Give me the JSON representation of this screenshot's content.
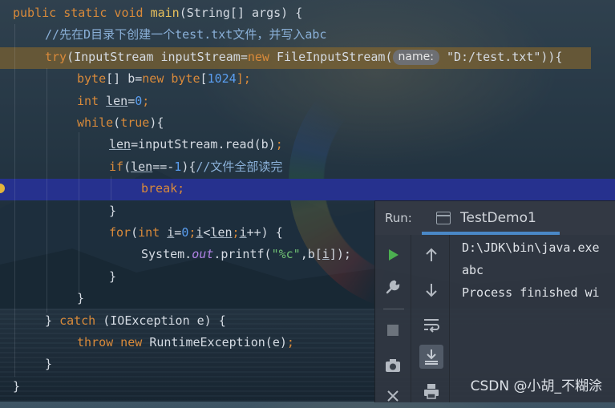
{
  "code_lines": [
    {
      "indent": 0,
      "tokens": [
        {
          "t": "public static void ",
          "c": "kw"
        },
        {
          "t": "main",
          "c": "fn"
        },
        {
          "t": "(String[] args) {",
          "c": "plain"
        }
      ]
    },
    {
      "indent": 1,
      "tokens": [
        {
          "t": "//先在D目录下创建一个test.txt文件，并写入abc",
          "c": "cm"
        }
      ]
    },
    {
      "indent": 1,
      "tokens": [
        {
          "t": "try",
          "c": "kw"
        },
        {
          "t": "(InputStream inputStream=",
          "c": "plain"
        },
        {
          "t": "new ",
          "c": "kw"
        },
        {
          "t": "FileInputStream(",
          "c": "plain"
        },
        {
          "t": "name:",
          "c": "hint"
        },
        {
          "t": "\"D:/test.txt\"",
          "c": "plain"
        },
        {
          "t": ")){",
          "c": "plain"
        }
      ]
    },
    {
      "indent": 2,
      "tokens": [
        {
          "t": "byte",
          "c": "kw"
        },
        {
          "t": "[] b=",
          "c": "plain"
        },
        {
          "t": "new ",
          "c": "kw"
        },
        {
          "t": "byte",
          "c": "kw"
        },
        {
          "t": "[",
          "c": "plain"
        },
        {
          "t": "1024",
          "c": "num"
        },
        {
          "t": "];",
          "c": "kw"
        }
      ]
    },
    {
      "indent": 2,
      "tokens": [
        {
          "t": "int ",
          "c": "kw"
        },
        {
          "t": "len",
          "c": "ul"
        },
        {
          "t": "=",
          "c": "plain"
        },
        {
          "t": "0",
          "c": "num"
        },
        {
          "t": ";",
          "c": "kw"
        }
      ]
    },
    {
      "indent": 2,
      "tokens": [
        {
          "t": "while",
          "c": "kw"
        },
        {
          "t": "(",
          "c": "plain"
        },
        {
          "t": "true",
          "c": "kw"
        },
        {
          "t": "){",
          "c": "plain"
        }
      ]
    },
    {
      "indent": 3,
      "tokens": [
        {
          "t": "len",
          "c": "ul"
        },
        {
          "t": "=inputStream.read(b)",
          "c": "plain"
        },
        {
          "t": ";",
          "c": "kw"
        }
      ]
    },
    {
      "indent": 3,
      "tokens": [
        {
          "t": "if",
          "c": "kw"
        },
        {
          "t": "(",
          "c": "plain"
        },
        {
          "t": "len",
          "c": "ul"
        },
        {
          "t": "==-",
          "c": "plain"
        },
        {
          "t": "1",
          "c": "num"
        },
        {
          "t": "){",
          "c": "plain"
        },
        {
          "t": "//文件全部读完",
          "c": "cm"
        }
      ]
    },
    {
      "indent": 4,
      "tokens": [
        {
          "t": "break",
          "c": "kw"
        },
        {
          "t": ";",
          "c": "kw"
        }
      ]
    },
    {
      "indent": 3,
      "tokens": [
        {
          "t": "}",
          "c": "plain"
        }
      ]
    },
    {
      "indent": 3,
      "tokens": [
        {
          "t": "for",
          "c": "kw"
        },
        {
          "t": "(",
          "c": "plain"
        },
        {
          "t": "int ",
          "c": "kw"
        },
        {
          "t": "i",
          "c": "ul"
        },
        {
          "t": "=",
          "c": "plain"
        },
        {
          "t": "0",
          "c": "num"
        },
        {
          "t": ";",
          "c": "kw"
        },
        {
          "t": "i",
          "c": "ul"
        },
        {
          "t": "<",
          "c": "plain"
        },
        {
          "t": "len",
          "c": "ul"
        },
        {
          "t": ";",
          "c": "kw"
        },
        {
          "t": "i",
          "c": "ul"
        },
        {
          "t": "++) {",
          "c": "plain"
        }
      ]
    },
    {
      "indent": 4,
      "tokens": [
        {
          "t": "System.",
          "c": "plain"
        },
        {
          "t": "out",
          "c": "it"
        },
        {
          "t": ".printf(",
          "c": "plain"
        },
        {
          "t": "\"%c\"",
          "c": "str"
        },
        {
          "t": ",b[",
          "c": "plain"
        },
        {
          "t": "i",
          "c": "ul"
        },
        {
          "t": "]);",
          "c": "plain"
        }
      ]
    },
    {
      "indent": 3,
      "tokens": [
        {
          "t": "}",
          "c": "plain"
        }
      ]
    },
    {
      "indent": 2,
      "tokens": [
        {
          "t": "}",
          "c": "plain"
        }
      ]
    },
    {
      "indent": 1,
      "tokens": [
        {
          "t": "} ",
          "c": "plain"
        },
        {
          "t": "catch ",
          "c": "kw"
        },
        {
          "t": "(IOException e) {",
          "c": "plain"
        }
      ]
    },
    {
      "indent": 2,
      "tokens": [
        {
          "t": "throw new ",
          "c": "kw"
        },
        {
          "t": "RuntimeException(e)",
          "c": "plain"
        },
        {
          "t": ";",
          "c": "kw"
        }
      ]
    },
    {
      "indent": 1,
      "tokens": [
        {
          "t": "}",
          "c": "plain"
        }
      ]
    },
    {
      "indent": 0,
      "tokens": [
        {
          "t": "}",
          "c": "plain"
        }
      ]
    }
  ],
  "run_panel": {
    "label": "Run:",
    "tab_label": "TestDemo1",
    "console_lines": [
      "D:\\JDK\\bin\\java.exe",
      "abc",
      "Process finished wi"
    ],
    "left_toolbar": [
      "run-icon",
      "wrench-icon",
      "stop-icon",
      "camera-icon",
      "exit-icon"
    ],
    "right_toolbar": [
      "arrow-up-icon",
      "arrow-down-icon",
      "soft-wrap-icon",
      "scroll-to-end-icon",
      "print-icon"
    ]
  },
  "watermark": "CSDN @小胡_不糊涂",
  "colors": {
    "keyword": "#d98a3a",
    "function": "#e8c15c",
    "number": "#5a9ef0",
    "comment": "#8ab0d8",
    "string": "#6fbf73",
    "field": "#b183e6",
    "break_line_highlight": "#26318e",
    "try_line_highlight": "#8a6a2e",
    "run_tab_underline": "#4a88c7",
    "run_icon": "#4caf50"
  }
}
